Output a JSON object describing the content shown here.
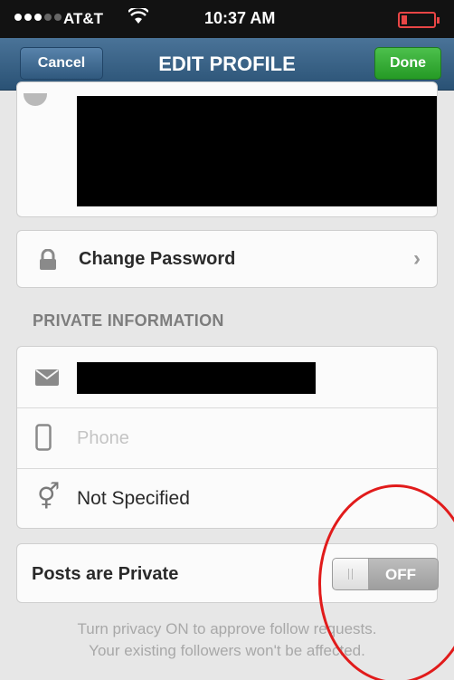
{
  "status_bar": {
    "carrier": "AT&T",
    "time": "10:37 AM",
    "signal_bars": 3,
    "signal_total": 5,
    "wifi_icon": "wifi-icon",
    "battery_color": "#e84545"
  },
  "nav": {
    "cancel_label": "Cancel",
    "title": "EDIT PROFILE",
    "done_label": "Done",
    "bar_color": "#2a5275",
    "done_color": "#259a25"
  },
  "change_password": {
    "icon": "lock-icon",
    "label": "Change Password",
    "chevron": "›"
  },
  "private_info": {
    "header": "PRIVATE INFORMATION",
    "email_icon": "mail-icon",
    "phone_icon": "phone-icon",
    "phone_placeholder": "Phone",
    "phone_value": "",
    "gender_icon": "gender-icon",
    "gender_symbol": "⚥",
    "gender_value": "Not Specified"
  },
  "privacy": {
    "label": "Posts are Private",
    "toggle_state": "OFF",
    "footnote_line1": "Turn privacy ON to approve follow requests.",
    "footnote_line2": "Your existing followers won't be affected."
  },
  "annotation": {
    "color": "#e11b1b"
  }
}
